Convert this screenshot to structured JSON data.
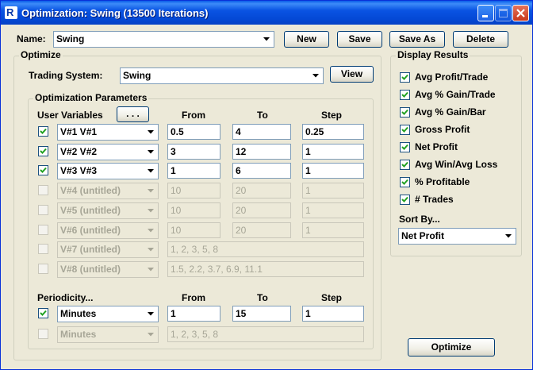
{
  "window": {
    "title": "Optimization: Swing (13500 Iterations)"
  },
  "header": {
    "name_label": "Name:",
    "name_value": "Swing",
    "new_label": "New",
    "save_label": "Save",
    "save_as_label": "Save As",
    "delete_label": "Delete"
  },
  "optimize": {
    "group_label": "Optimize",
    "trading_system_label": "Trading System:",
    "trading_system_value": "Swing",
    "view_label": "View",
    "params": {
      "group_label": "Optimization Parameters",
      "user_variables_label": "User Variables",
      "ellipsis_label": ". . .",
      "col_from": "From",
      "col_to": "To",
      "col_step": "Step",
      "rows": [
        {
          "checked": true,
          "enabled": true,
          "variable": "V#1  V#1",
          "from": "0.5",
          "to": "4",
          "step": "0.25"
        },
        {
          "checked": true,
          "enabled": true,
          "variable": "V#2  V#2",
          "from": "3",
          "to": "12",
          "step": "1"
        },
        {
          "checked": true,
          "enabled": true,
          "variable": "V#3  V#3",
          "from": "1",
          "to": "6",
          "step": "1"
        },
        {
          "checked": false,
          "enabled": false,
          "variable": "V#4 (untitled)",
          "from": "10",
          "to": "20",
          "step": "1"
        },
        {
          "checked": false,
          "enabled": false,
          "variable": "V#5 (untitled)",
          "from": "10",
          "to": "20",
          "step": "1"
        },
        {
          "checked": false,
          "enabled": false,
          "variable": "V#6 (untitled)",
          "from": "10",
          "to": "20",
          "step": "1"
        },
        {
          "checked": false,
          "enabled": false,
          "variable": "V#7 (untitled)",
          "list": "1, 2, 3, 5, 8"
        },
        {
          "checked": false,
          "enabled": false,
          "variable": "V#8 (untitled)",
          "list": "1.5, 2.2, 3.7, 6.9, 11.1"
        }
      ],
      "periodicity_label": "Periodicity...",
      "periodicity_rows": [
        {
          "checked": true,
          "enabled": true,
          "variable": "Minutes",
          "from": "1",
          "to": "15",
          "step": "1"
        },
        {
          "checked": false,
          "enabled": false,
          "variable": "Minutes",
          "list": "1, 2, 3, 5, 8"
        }
      ]
    }
  },
  "display_results": {
    "group_label": "Display Results",
    "items": [
      {
        "label": "Avg Profit/Trade",
        "checked": true
      },
      {
        "label": "Avg % Gain/Trade",
        "checked": true
      },
      {
        "label": "Avg % Gain/Bar",
        "checked": true
      },
      {
        "label": "Gross Profit",
        "checked": true
      },
      {
        "label": "Net Profit",
        "checked": true
      },
      {
        "label": "Avg Win/Avg Loss",
        "checked": true
      },
      {
        "label": "% Profitable",
        "checked": true
      },
      {
        "label": "# Trades",
        "checked": true
      }
    ],
    "sort_by_label": "Sort By...",
    "sort_by_value": "Net Profit"
  },
  "footer": {
    "optimize_label": "Optimize"
  }
}
